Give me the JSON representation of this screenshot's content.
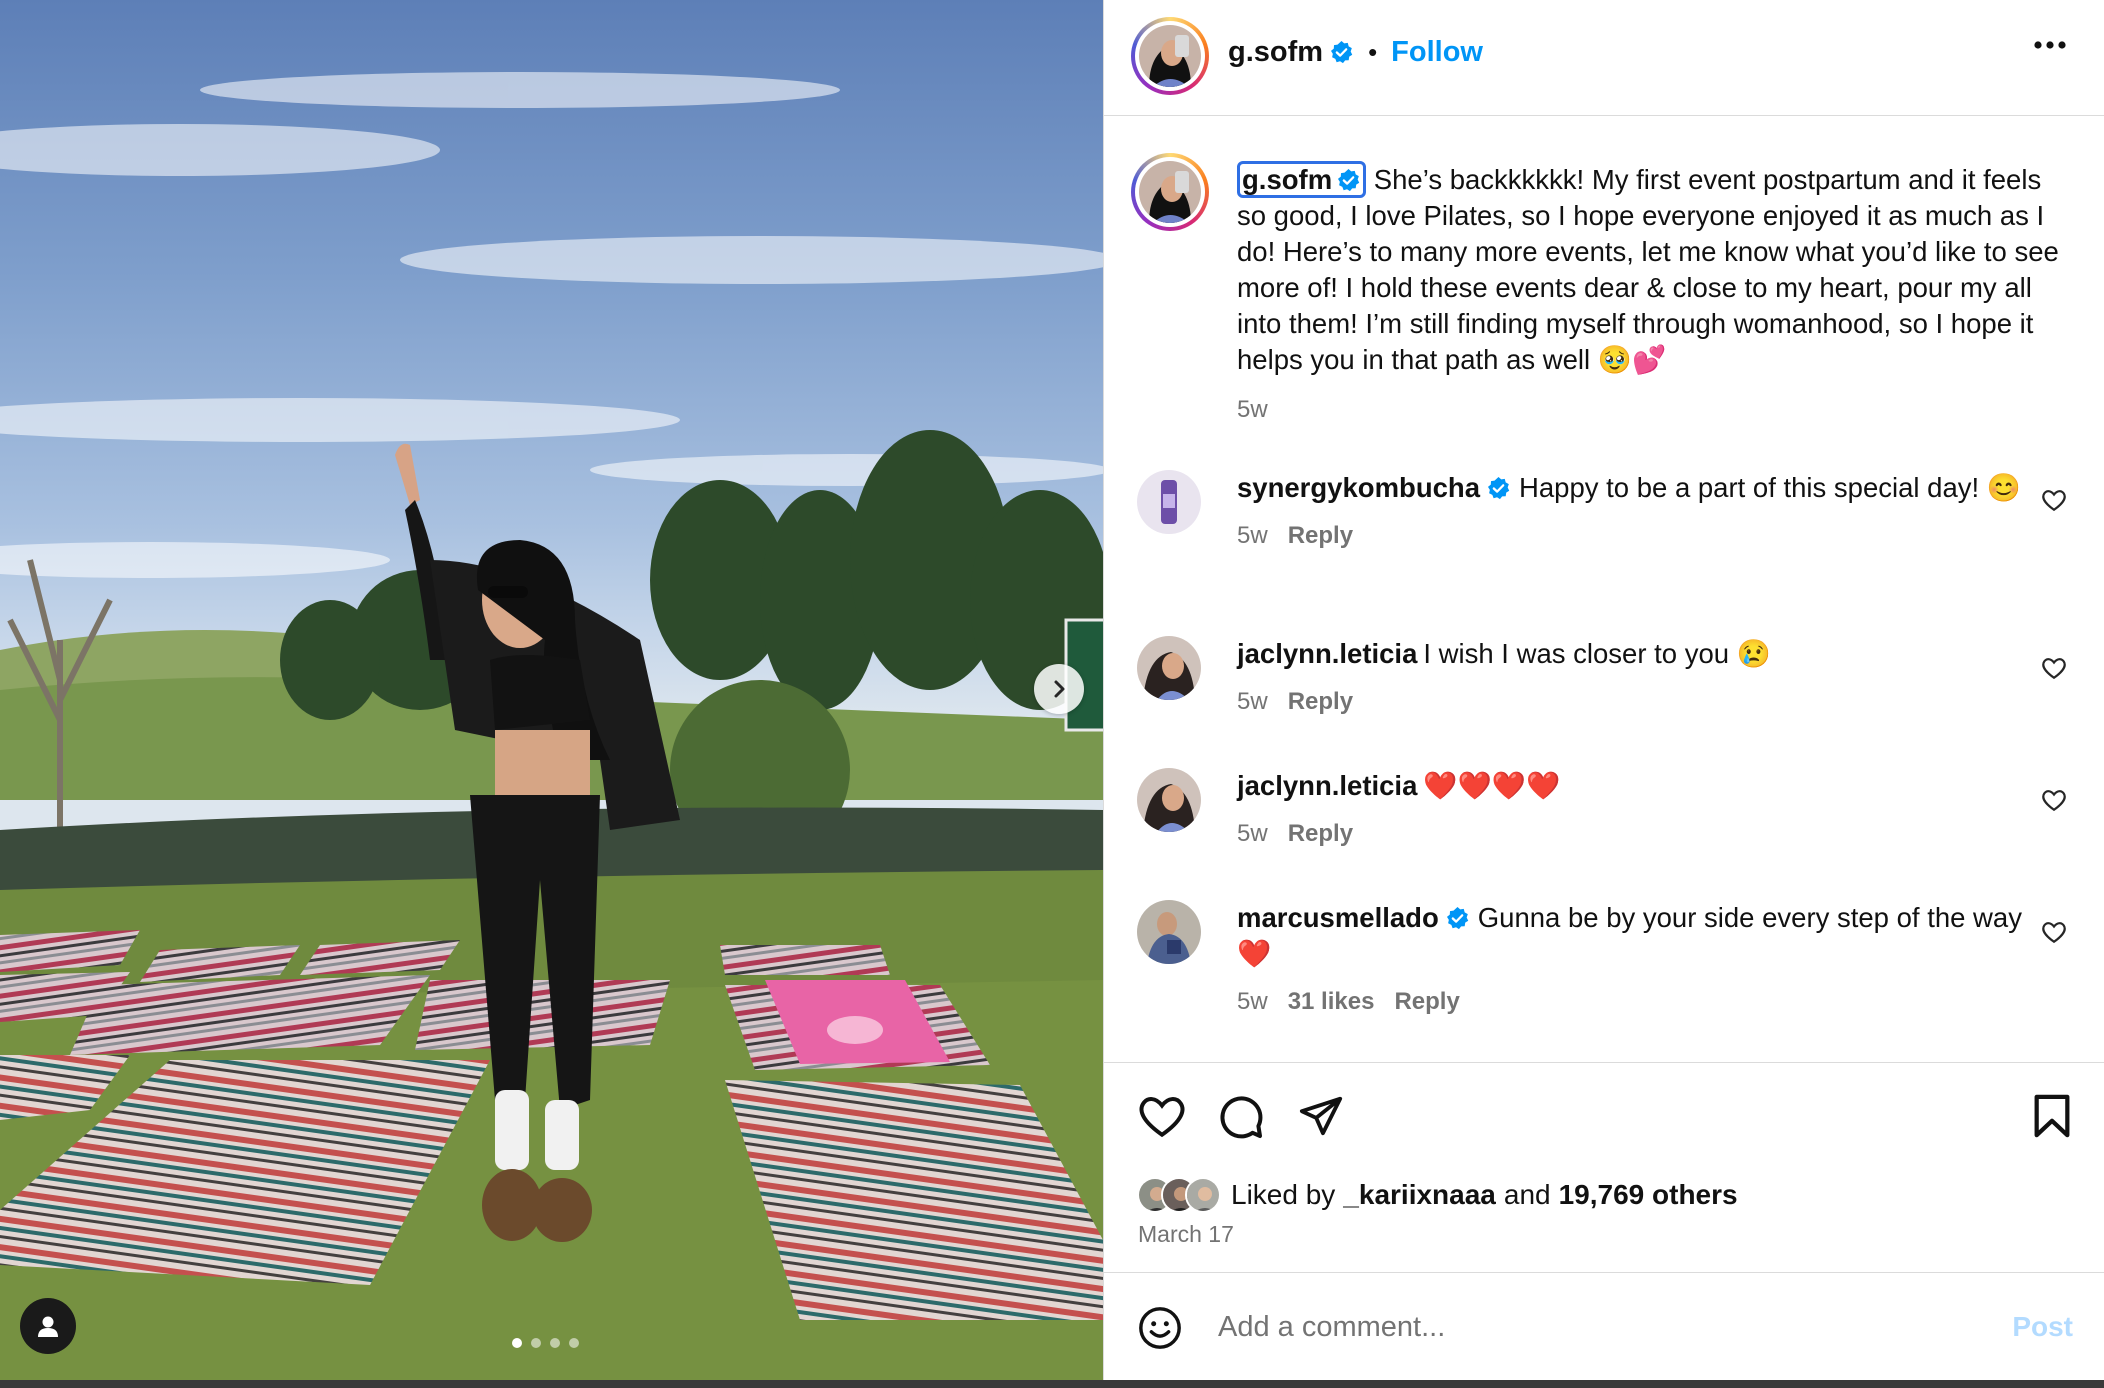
{
  "post_header": {
    "username": "g.sofm",
    "separator": "•",
    "follow_label": "Follow"
  },
  "caption": {
    "username": "g.sofm",
    "text": "She’s backkkkkk! My first event postpartum and it feels so good, I love Pilates, so I hope everyone enjoyed it as much as I do! Here’s to many more events, let me know what you’d like to see more of! I hold these events dear & close to my heart, pour my all into them! I’m still finding myself through womanhood, so I hope it helps you in that path as well 🥹💕",
    "time": "5w"
  },
  "comments": [
    {
      "username": "synergykombucha",
      "verified": true,
      "text": "Happy to be a part of this special day! 😊",
      "time": "5w",
      "likes": "",
      "reply_label": "Reply"
    },
    {
      "username": "jaclynn.leticia",
      "verified": false,
      "text": "I wish I was closer to you 😢",
      "time": "5w",
      "likes": "",
      "reply_label": "Reply"
    },
    {
      "username": "jaclynn.leticia",
      "verified": false,
      "text": "❤️❤️❤️❤️",
      "time": "5w",
      "likes": "",
      "reply_label": "Reply"
    },
    {
      "username": "marcusmellado",
      "verified": true,
      "text": "Gunna be by your side every step of the way ❤️",
      "time": "5w",
      "likes": "31 likes",
      "reply_label": "Reply"
    }
  ],
  "likes": {
    "prefix": "Liked by",
    "first_user": "_kariixnaaa",
    "conj": "and",
    "others": "19,769 others"
  },
  "date": "March 17",
  "add_comment": {
    "placeholder": "Add a comment...",
    "post_label": "Post"
  },
  "carousel": {
    "slides": 4,
    "active_index": 0
  },
  "colors": {
    "accent": "#0095f6",
    "verified": "#0095f6",
    "muted": "#737373",
    "post_disabled": "#b3dbff"
  },
  "icons": [
    "more-icon",
    "verified-icon",
    "heart-icon",
    "comment-icon",
    "share-icon",
    "bookmark-icon",
    "emoji-icon",
    "chevron-right-icon",
    "user-tag-icon"
  ]
}
